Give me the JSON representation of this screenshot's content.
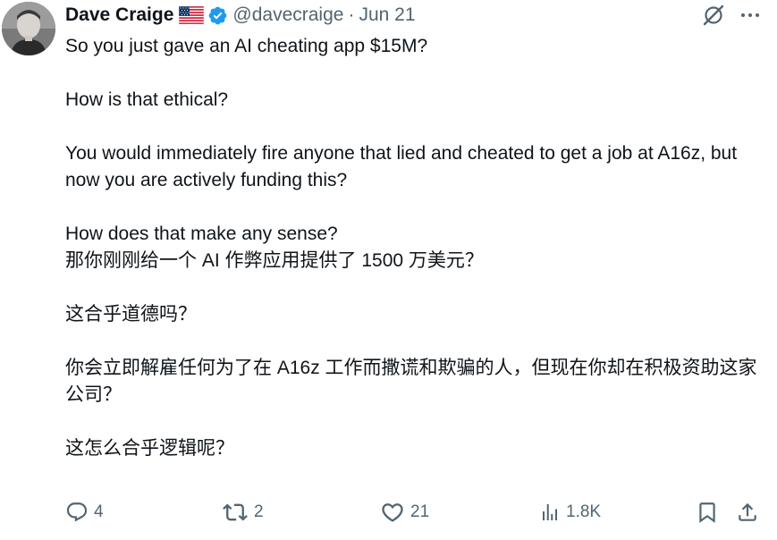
{
  "tweet": {
    "author_name": "Dave Craige",
    "handle": "@davecraige",
    "separator": "·",
    "date": "Jun 21",
    "paragraphs_en": [
      "So you just gave an AI cheating app $15M?",
      "How is that ethical?",
      "You would immediately fire anyone that lied and cheated to get a job at A16z, but now you are actively funding this?",
      "How does that make any sense?"
    ],
    "paragraphs_zh": [
      "那你刚刚给一个 AI 作弊应用提供了 1500 万美元？",
      "这合乎道德吗？",
      "你会立即解雇任何为了在 A16z 工作而撒谎和欺骗的人，但现在你却在积极资助这家公司？",
      "这怎么合乎逻辑呢？"
    ]
  },
  "actions": {
    "replies": "4",
    "retweets": "2",
    "likes": "21",
    "views": "1.8K"
  },
  "icons": {
    "flag": "us-flag-icon",
    "verified": "verified-badge-icon",
    "grok": "grok-icon",
    "more": "more-icon",
    "reply": "reply-icon",
    "retweet": "retweet-icon",
    "like": "heart-icon",
    "views": "views-icon",
    "bookmark": "bookmark-icon",
    "share": "share-icon"
  },
  "colors": {
    "text": "#0f1419",
    "muted": "#536471",
    "verified": "#1d9bf0"
  }
}
